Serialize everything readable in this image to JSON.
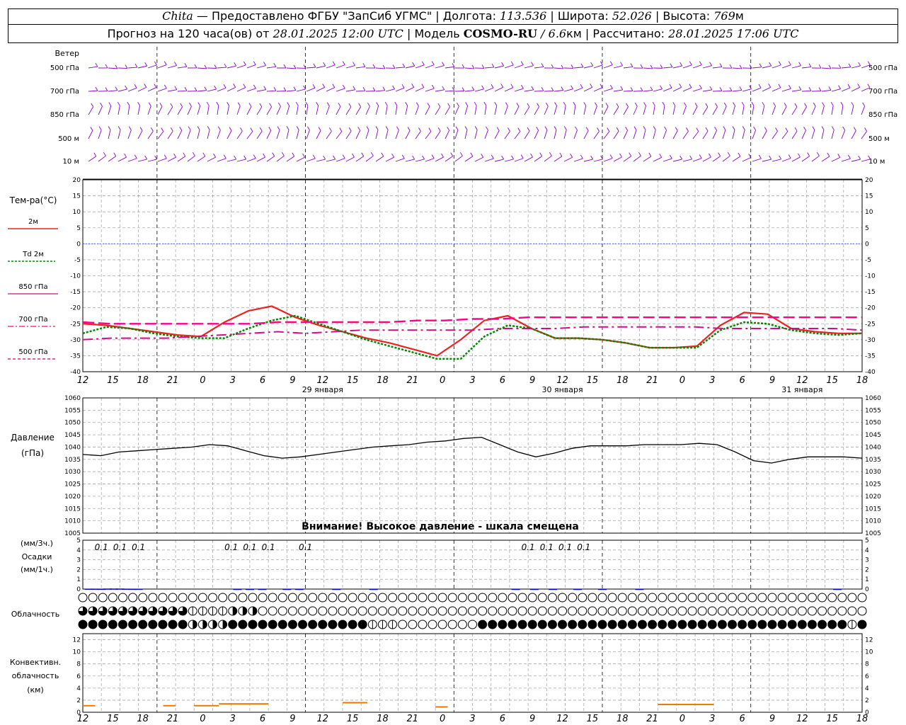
{
  "header": {
    "station": "Chita",
    "provider": " — Предоставлено ФГБУ \"ЗапСиб УГМС\" | Долгота: ",
    "lon": "113.536",
    "lat_label": " | Широта: ",
    "lat": "52.026",
    "alt_label": " | Высота: ",
    "alt": "769",
    "alt_unit": "м",
    "forecast_label": "Прогноз на 120 часа(ов) от ",
    "forecast_from": "28.01.2025 12:00 UTC",
    "model_label": " | Модель ",
    "model": "COSMO-RU",
    "res": " / 6.6",
    "res_unit": "км",
    "calc_label": " | Рассчитано: ",
    "calc_time": "28.01.2025 17:06 UTC"
  },
  "labels": {
    "wind_title": "Ветер",
    "wind_levels": [
      "500 гПа",
      "700 гПа",
      "850 гПа",
      "500 м",
      "10 м"
    ],
    "temp_title": "Тем-ра(°C)",
    "temp_legend": [
      "2м",
      "Td 2м",
      "850 гПа",
      "700 гПа",
      "500 гПа"
    ],
    "pressure_title": "Давление",
    "pressure_unit": "(гПа)",
    "pressure_warning": "Внимание! Высокое давление - шкала смещена",
    "precip_title_1": "(мм/3ч.)",
    "precip_title_2": "Осадки",
    "precip_title_3": "(мм/1ч.)",
    "cloud_title": "Облачность",
    "conv_title_1": "Конвективн.",
    "conv_title_2": "облачность",
    "conv_title_3": "(км)"
  },
  "time_axis": {
    "hour_labels": [
      "12",
      "15",
      "18",
      "21",
      "0",
      "3",
      "6",
      "9",
      "12",
      "15",
      "18",
      "21",
      "0",
      "3",
      "6",
      "9",
      "12",
      "15",
      "18",
      "21",
      "0",
      "3",
      "6",
      "9",
      "12",
      "15",
      "18"
    ],
    "date_labels": [
      {
        "text": "29 января",
        "hour_index": 8
      },
      {
        "text": "30 января",
        "hour_index": 16
      },
      {
        "text": "31 января",
        "hour_index": 24
      }
    ]
  },
  "colors": {
    "t2m": "#ee2222",
    "td2m": "#008800",
    "t850": "#cc1188",
    "t700": "#ff0088",
    "t500": "#cc0066",
    "zero": "#4466ff",
    "wind": "#8800cc",
    "pressure": "#000000",
    "precip": "#0000cc",
    "conv": "#ee7700"
  },
  "chart_data": [
    {
      "type": "line",
      "name": "temperature",
      "x_hours": [
        0,
        3,
        6,
        9,
        12,
        15,
        18,
        21,
        24,
        27,
        30,
        33,
        36,
        39,
        42,
        45,
        48,
        51,
        54,
        57,
        60,
        63,
        66,
        69,
        72,
        75,
        78,
        81,
        84,
        87,
        90,
        93,
        96,
        99,
        102,
        105,
        108,
        111,
        114,
        117,
        120,
        123,
        126
      ],
      "ylim": [
        -40,
        20
      ],
      "yticks": [
        20,
        15,
        10,
        5,
        0,
        -5,
        -10,
        -15,
        -20,
        -25,
        -30,
        -35,
        -40
      ],
      "series": [
        {
          "name": "2м",
          "values": [
            -25,
            -25.5,
            -26.5,
            -27.5,
            -28.5,
            -29,
            -24.5,
            -21,
            -19.5,
            -23,
            -25.5,
            -27.5,
            -29.5,
            -31,
            -33,
            -35,
            -30,
            -24,
            -22.5,
            -26.5,
            -29.5,
            -29.5,
            -30,
            -31,
            -32.5,
            -32.5,
            -32,
            -25.5,
            -21.5,
            -22,
            -26.5,
            -27.5,
            -28,
            -28
          ]
        },
        {
          "name": "Td 2м",
          "values": [
            -28,
            -26,
            -26.5,
            -28,
            -29,
            -29.5,
            -29.5,
            -26.5,
            -24,
            -22.5,
            -25,
            -27.5,
            -30,
            -32,
            -34,
            -36,
            -36,
            -29,
            -25.5,
            -26.5,
            -29.5,
            -29.5,
            -30,
            -31,
            -32.5,
            -32.5,
            -32.5,
            -27,
            -24.5,
            -25,
            -27,
            -28,
            -28.5,
            -28
          ]
        },
        {
          "name": "850 гПа",
          "values": [
            -30,
            -29.5,
            -29.5,
            -29.5,
            -29,
            -28.5,
            -28,
            -27.5,
            -28,
            -27.5,
            -27,
            -27,
            -27,
            -27,
            -27,
            -26.5,
            -26.5,
            -26.5,
            -26,
            -26,
            -26,
            -26,
            -26,
            -26.5,
            -26.5,
            -26.5,
            -26.5,
            -26.5,
            -27
          ]
        },
        {
          "name": "700 гПа",
          "values": [
            -24.5,
            -25,
            -25,
            -25,
            -25,
            -25,
            -25,
            -24.5,
            -24.5,
            -24.5,
            -24.5,
            -24.5,
            -24,
            -24,
            -23.5,
            -23.5,
            -23,
            -23,
            -23,
            -23,
            -23,
            -23,
            -23,
            -23,
            -23,
            -23,
            -23,
            -23,
            -23
          ]
        }
      ]
    },
    {
      "type": "line",
      "name": "pressure",
      "ylim": [
        1005,
        1060
      ],
      "yticks": [
        1060,
        1055,
        1050,
        1045,
        1040,
        1035,
        1030,
        1025,
        1020,
        1015,
        1010,
        1005
      ],
      "x_hours": [
        0,
        3,
        6,
        9,
        12,
        15,
        18,
        21,
        24,
        27,
        30,
        33,
        36,
        39,
        42,
        45,
        48,
        51,
        54,
        57,
        60,
        63,
        66,
        69,
        72,
        75,
        78,
        81,
        84,
        87,
        90,
        93,
        96,
        99,
        102,
        105,
        108,
        111,
        114,
        117,
        120,
        123,
        126
      ],
      "values": [
        1037,
        1036.5,
        1038,
        1038.5,
        1039,
        1039.5,
        1040,
        1041,
        1040.5,
        1038.5,
        1036.5,
        1035.5,
        1036,
        1037,
        1038,
        1039,
        1040,
        1040.5,
        1041,
        1042,
        1042.5,
        1043.5,
        1044,
        1041,
        1038,
        1036,
        1037.5,
        1039.5,
        1040.5,
        1040.5,
        1040.5,
        1041,
        1041,
        1041,
        1041.5,
        1041,
        1038,
        1034.5,
        1033.5,
        1035,
        1036,
        1036,
        1036,
        1035.5
      ]
    },
    {
      "type": "bar",
      "name": "precipitation",
      "ylim": [
        0,
        5
      ],
      "labels_3h": [
        {
          "hour": 3,
          "text": "0.1"
        },
        {
          "hour": 6,
          "text": "0.1"
        },
        {
          "hour": 9,
          "text": "0.1"
        },
        {
          "hour": 24,
          "text": "0.1"
        },
        {
          "hour": 27,
          "text": "0.1"
        },
        {
          "hour": 30,
          "text": "0.1"
        },
        {
          "hour": 36,
          "text": "0.1"
        },
        {
          "hour": 72,
          "text": "0.1"
        },
        {
          "hour": 75,
          "text": "0.1"
        },
        {
          "hour": 78,
          "text": "0.1"
        },
        {
          "hour": 81,
          "text": "0.1"
        }
      ],
      "hourly": [
        {
          "hour": 1,
          "value": 0.2
        },
        {
          "hour": 2,
          "value": 0.2
        },
        {
          "hour": 3,
          "value": 0.15
        },
        {
          "hour": 4,
          "value": 0.25
        },
        {
          "hour": 5,
          "value": 0.25
        },
        {
          "hour": 6,
          "value": 0.25
        },
        {
          "hour": 7,
          "value": 0.2
        },
        {
          "hour": 8,
          "value": 0.15
        },
        {
          "hour": 9,
          "value": 0.15
        },
        {
          "hour": 25,
          "value": 0.1
        },
        {
          "hour": 27,
          "value": 0.1
        },
        {
          "hour": 29,
          "value": 0.1
        },
        {
          "hour": 33,
          "value": 0.1
        },
        {
          "hour": 35,
          "value": 0.1
        },
        {
          "hour": 41,
          "value": 0.1
        },
        {
          "hour": 47,
          "value": 0.1
        },
        {
          "hour": 70,
          "value": 0.1
        },
        {
          "hour": 73,
          "value": 0.1
        },
        {
          "hour": 76,
          "value": 0.1
        },
        {
          "hour": 80,
          "value": 0.1
        },
        {
          "hour": 84,
          "value": 0.1
        },
        {
          "hour": 90,
          "value": 0.1
        },
        {
          "hour": 122,
          "value": 0.1
        }
      ]
    },
    {
      "type": "area",
      "name": "convective_cloud",
      "ylim": [
        0,
        13
      ],
      "yticks": [
        12,
        10,
        8,
        6,
        4,
        2,
        0
      ],
      "segments": [
        {
          "from": 0,
          "to": 2,
          "base": 0,
          "top": 1.2
        },
        {
          "from": 13,
          "to": 15,
          "base": 0,
          "top": 1.2
        },
        {
          "from": 18,
          "to": 22,
          "base": 0,
          "top": 1.2
        },
        {
          "from": 22,
          "to": 30,
          "base": 0,
          "top": 1.5
        },
        {
          "from": 42,
          "to": 46,
          "base": 0,
          "top": 1.7
        },
        {
          "from": 57,
          "to": 59,
          "base": 0,
          "top": 1.0
        },
        {
          "from": 93,
          "to": 102,
          "base": 0,
          "top": 1.4
        }
      ]
    }
  ],
  "cloud_rows": {
    "row1": "oooooooooooooooooooooooooooooooooooooooooooooooooooooooooooooooooooooooooooooooooooooooooooooooooooooooooooooooooooooooooooooooooooooooooooooooooooooooooooooooooooooooooo",
    "row2": "ttttttttttttttttttttttqqqqqqqqqhhhhhhooooooooooooooooooooooooooooooooooooooooooooooooooooooooooooooooooooooooooooooooooooooooooooooooooooooooooooooooooooooooooooooqt",
    "row3": "ffffffffffffffffffffffhhhhhhhhffffffffffffffffffffffffffffqqqqqqoooooooooooooooooffffffffffffffffffffffffffffffffffffffffffffffffffffffffffffffffffffffffffffoqffff"
  }
}
